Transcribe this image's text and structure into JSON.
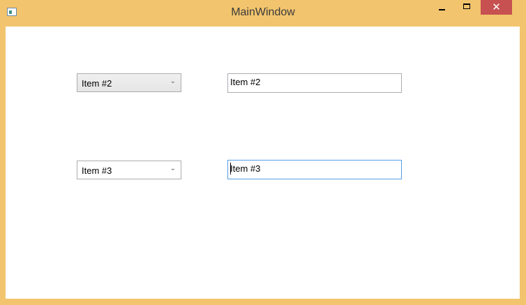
{
  "window": {
    "title": "MainWindow",
    "close_glyph": "✕"
  },
  "rows": [
    {
      "combo_value": "Item #2",
      "textbox_value": "Item #2"
    },
    {
      "combo_value": "Item #3",
      "textbox_value": "Item #3"
    }
  ],
  "colors": {
    "frame": "#f2c46d",
    "close_button": "#c75050",
    "focus_border": "#569de5"
  },
  "icons": {
    "combo_arrow": "chevron-down-icon"
  }
}
